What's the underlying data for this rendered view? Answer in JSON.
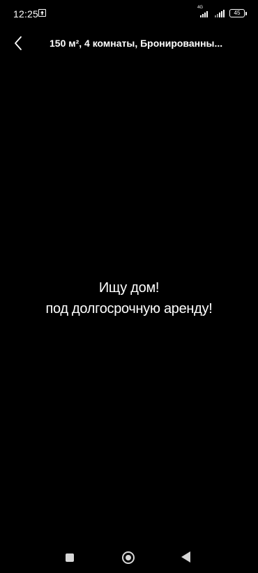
{
  "status_bar": {
    "time": "12:25",
    "network": "4G",
    "battery": "45"
  },
  "header": {
    "title": "150 м², 4 комнаты, Бронированны..."
  },
  "ad": {
    "line1": "Ищу дом!",
    "line2": "под долгосрочную аренду!"
  },
  "icons": {
    "back": "chevron-left-icon",
    "upload": "upload-icon",
    "signal": "signal-icon",
    "battery": "battery-icon",
    "nav_recent": "square-icon",
    "nav_home": "circle-icon",
    "nav_back": "triangle-back-icon"
  }
}
